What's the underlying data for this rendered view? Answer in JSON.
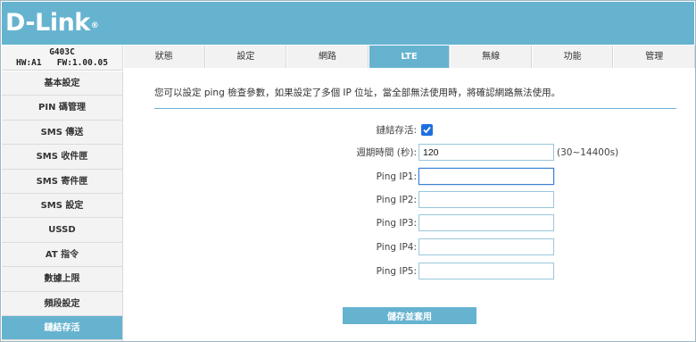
{
  "header": {
    "logo_text": "D-Link",
    "logo_mark": "®"
  },
  "device": {
    "model": "G403C",
    "hw": "HW:A1",
    "fw": "FW:1.00.05"
  },
  "tabs": [
    {
      "label": "狀態"
    },
    {
      "label": "設定"
    },
    {
      "label": "網路"
    },
    {
      "label": "LTE",
      "active": true
    },
    {
      "label": "無線"
    },
    {
      "label": "功能"
    },
    {
      "label": "管理"
    }
  ],
  "sidebar": {
    "items": [
      {
        "label": "基本設定"
      },
      {
        "label": "PIN 碼管理"
      },
      {
        "label": "SMS 傳送"
      },
      {
        "label": "SMS 收件匣"
      },
      {
        "label": "SMS 寄件匣"
      },
      {
        "label": "SMS 設定"
      },
      {
        "label": "USSD"
      },
      {
        "label": "AT 指令"
      },
      {
        "label": "數據上限"
      },
      {
        "label": "頻段設定"
      },
      {
        "label": "鏈結存活",
        "active": true
      }
    ]
  },
  "main": {
    "description": "您可以設定 ping 檢查參數，如果設定了多個 IP 位址，當全部無法使用時，將確認網路無法使用。",
    "keepalive_label": "鏈結存活:",
    "keepalive_checked": true,
    "period_label": "週期時間 (秒):",
    "period_value": "120",
    "period_hint": "(30~14400s)",
    "ping_fields": [
      {
        "label": "Ping IP1:",
        "value": ""
      },
      {
        "label": "Ping IP2:",
        "value": ""
      },
      {
        "label": "Ping IP3:",
        "value": ""
      },
      {
        "label": "Ping IP4:",
        "value": ""
      },
      {
        "label": "Ping IP5:",
        "value": ""
      }
    ],
    "save_label": "儲存並套用"
  },
  "colors": {
    "accent": "#66b3d0",
    "checkbox": "#1f6fe0"
  }
}
